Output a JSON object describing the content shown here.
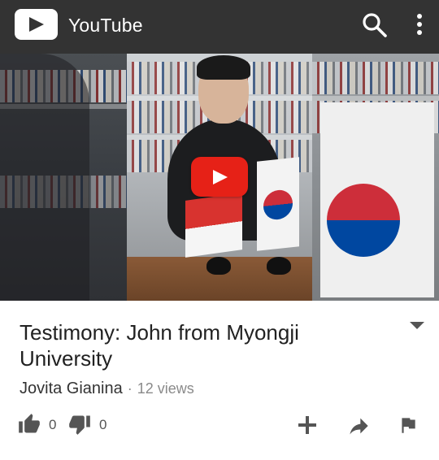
{
  "appbar": {
    "title": "YouTube",
    "logo_icon": "youtube-play-logo-icon",
    "search_icon": "search-icon",
    "menu_icon": "more-vert-icon",
    "background_color": "#333333"
  },
  "player": {
    "play_icon": "play-icon",
    "play_button_color": "#e62117"
  },
  "video": {
    "title": "Testimony: John from Myongji University",
    "expand_icon": "expand-arrow-icon",
    "channel": "Jovita Gianina",
    "separator": "·",
    "views": "12 views"
  },
  "actions": {
    "likes": "0",
    "dislikes": "0",
    "like_icon": "thumbs-up-icon",
    "dislike_icon": "thumbs-down-icon",
    "add_icon": "add-icon",
    "share_icon": "share-icon",
    "flag_icon": "flag-icon",
    "icon_color": "#555555"
  }
}
